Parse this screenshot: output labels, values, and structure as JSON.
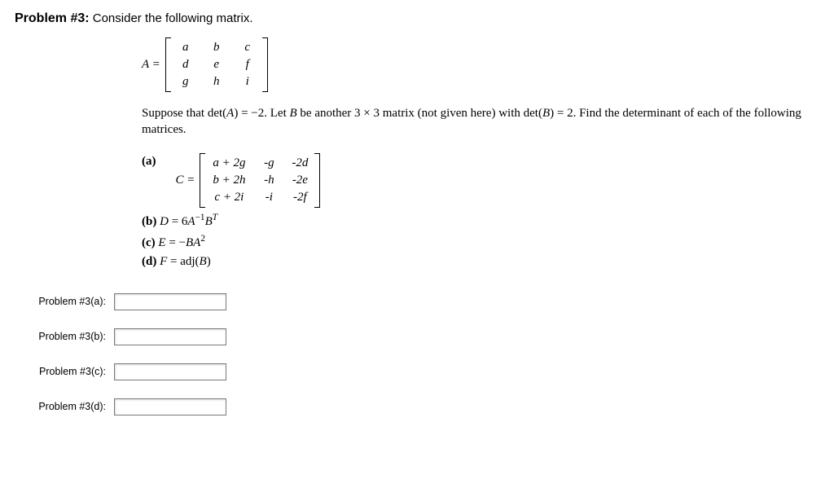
{
  "title_prefix": "Problem #3:",
  "title_rest": " Consider the following matrix.",
  "A_lhs": "A = ",
  "A_matrix": [
    [
      "a",
      "b",
      "c"
    ],
    [
      "d",
      "e",
      "f"
    ],
    [
      "g",
      "h",
      "i"
    ]
  ],
  "premise": "Suppose that det(A) = −2. Let B be another 3 × 3 matrix (not given here) with det(B) = 2. Find the determinant of each of the following matrices.",
  "parts": {
    "a": {
      "label": "(a)",
      "C_lhs": "C = ",
      "C_matrix": [
        [
          "a + 2g",
          "-g",
          "-2d"
        ],
        [
          "b + 2h",
          "-h",
          "-2e"
        ],
        [
          "c + 2i",
          "-i",
          "-2f"
        ]
      ]
    },
    "b": {
      "label": "(b)",
      "text_html": "D = 6A⁻¹Bᵀ"
    },
    "c": {
      "label": "(c)",
      "text_html": "E = −BA²"
    },
    "d": {
      "label": "(d)",
      "text_html": "F = adj(B)"
    }
  },
  "answers": [
    {
      "label": "Problem #3(a):",
      "value": ""
    },
    {
      "label": "Problem #3(b):",
      "value": ""
    },
    {
      "label": "Problem #3(c):",
      "value": ""
    },
    {
      "label": "Problem #3(d):",
      "value": ""
    }
  ]
}
